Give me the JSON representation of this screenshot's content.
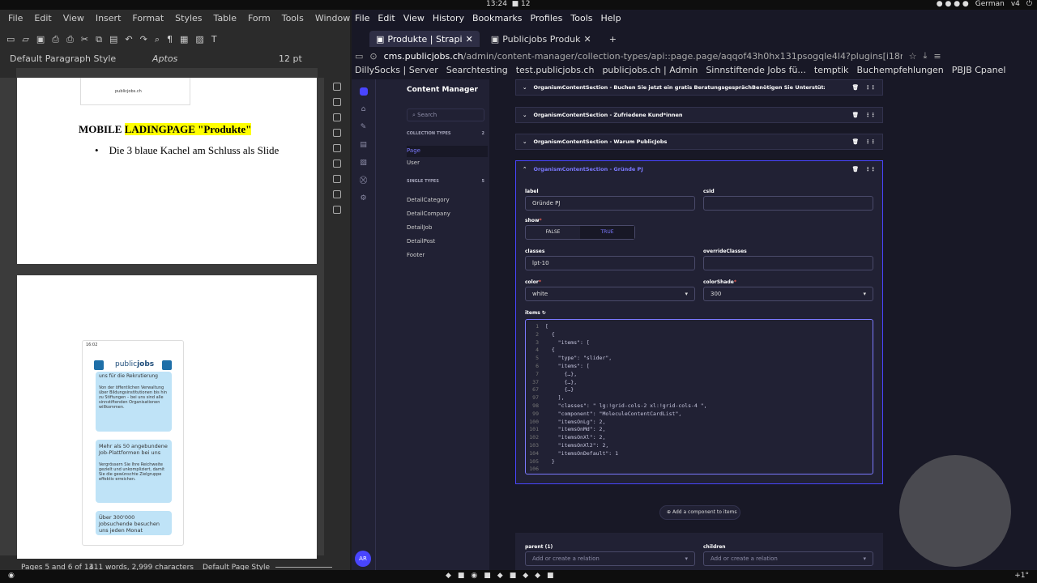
{
  "system": {
    "time": "13:24",
    "workspaces": "12",
    "layout": "German",
    "layout2": "v4",
    "weather": "+1°"
  },
  "writer": {
    "menu": [
      "File",
      "Edit",
      "View",
      "Insert",
      "Format",
      "Styles",
      "Table",
      "Form",
      "Tools",
      "Window",
      "Help"
    ],
    "para_style": "Default Paragraph Style",
    "font": "Aptos",
    "font_size": "12 pt",
    "heading_before": "MOBILE ",
    "heading_highlight": "LADINGPAGE \"Produkte\"",
    "bullet": "Die 3 blaue Kachel am Schluss als Slide",
    "thumb_logo": "publicjobs.ch",
    "phone": {
      "time": "16:02",
      "logo_a": "public",
      "logo_b": "jobs",
      "c1_title": "uns für die Rekrutierung",
      "c1_body": "Von der öffentlichen Verwaltung über Bildungsinstitutionen bis hin zu Stiftungen – bei uns sind alle sinnstiftenden Organisationen willkommen.",
      "c2_title": "Mehr als 50 angebundene Job-Plattformen bei uns",
      "c2_body": "Vergrössern Sie Ihre Reichweite gezielt und unkompliziert, damit Sie die gewünschte Zielgruppe effektiv erreichen.",
      "c3_title": "Über 300'000 Jobsuchende besuchen uns jeden Monat"
    },
    "status": {
      "pages": "Pages 5 and 6 of 13",
      "words": "411 words, 2,999 characters",
      "page_style": "Default Page Style"
    }
  },
  "browser": {
    "menu": [
      "File",
      "Edit",
      "View",
      "History",
      "Bookmarks",
      "Profiles",
      "Tools",
      "Help"
    ],
    "tabs": [
      {
        "label": "Produkte | Strapi"
      },
      {
        "label": "Publicjobs Produk"
      }
    ],
    "url_host": "cms.publicjobs.ch",
    "url_path": "/admin/content-manager/collection-types/api::page.page/aqqof43h0hx131psogqle4l4?plugins[i18n][locale]=de-CH",
    "bookmarks": [
      "DillySocks | Server",
      "Searchtesting",
      "test.publicjobs.ch",
      "publicjobs.ch | Admin",
      "Sinnstiftende Jobs fü...",
      "temptik",
      "Buchempfehlungen",
      "PBJB Cpanel"
    ]
  },
  "strapi": {
    "title": "Content Manager",
    "search": "Search",
    "coll_label": "COLLECTION TYPES",
    "coll_count": "2",
    "coll_items": [
      "Page",
      "User"
    ],
    "single_label": "SINGLE TYPES",
    "single_count": "5",
    "single_items": [
      "DetailCategory",
      "DetailCompany",
      "DetailJob",
      "DetailPost",
      "Footer"
    ],
    "sections": [
      "OrganismContentSection - Buchen Sie jetzt ein gratis BeratungsgesprächBenötigen Sie Unterstützung bei der R...",
      "OrganismContentSection - Zufriedene Kund*innen",
      "OrganismContentSection - Warum PublicJobs",
      "OrganismContentSection - Gründe PJ"
    ],
    "f_label": "label",
    "v_label": "Gründe PJ",
    "f_csid": "csId",
    "f_show": "show",
    "show_false": "FALSE",
    "show_true": "TRUE",
    "f_classes": "classes",
    "v_classes": "lpt-10",
    "f_override": "overrideClasses",
    "f_color": "color",
    "v_color": "white",
    "f_shade": "colorShade",
    "v_shade": "300",
    "f_items": "items",
    "code_lines": [
      [
        "1",
        "["
      ],
      [
        "2",
        "  {"
      ],
      [
        "3",
        "    \"items\": ["
      ],
      [
        "4",
        "  {"
      ],
      [
        "5",
        "    \"type\": \"slider\","
      ],
      [
        "6",
        "    \"items\": ["
      ],
      [
        "7",
        "      {…},"
      ],
      [
        "37",
        "      {…},"
      ],
      [
        "67",
        "      {…}"
      ],
      [
        "97",
        "    ],"
      ],
      [
        "98",
        "    \"classes\": \" lg:!grid-cols-2 xl:!grid-cols-4 \","
      ],
      [
        "99",
        "    \"component\": \"MoleculeContentCardList\","
      ],
      [
        "100",
        "    \"itemsOnLg\": 2,"
      ],
      [
        "101",
        "    \"itemsOnMd\": 2,"
      ],
      [
        "102",
        "    \"itemsOnXl\": 2,"
      ],
      [
        "103",
        "    \"itemsOnXl2\": 2,"
      ],
      [
        "104",
        "    \"itemsOnDefault\": 1"
      ],
      [
        "105",
        "  }"
      ],
      [
        "106",
        ""
      ]
    ],
    "add_component": "Add a component to items",
    "f_parent": "parent (1)",
    "f_children": "children",
    "relation_ph": "Add or create a relation",
    "avatar": "AR"
  }
}
